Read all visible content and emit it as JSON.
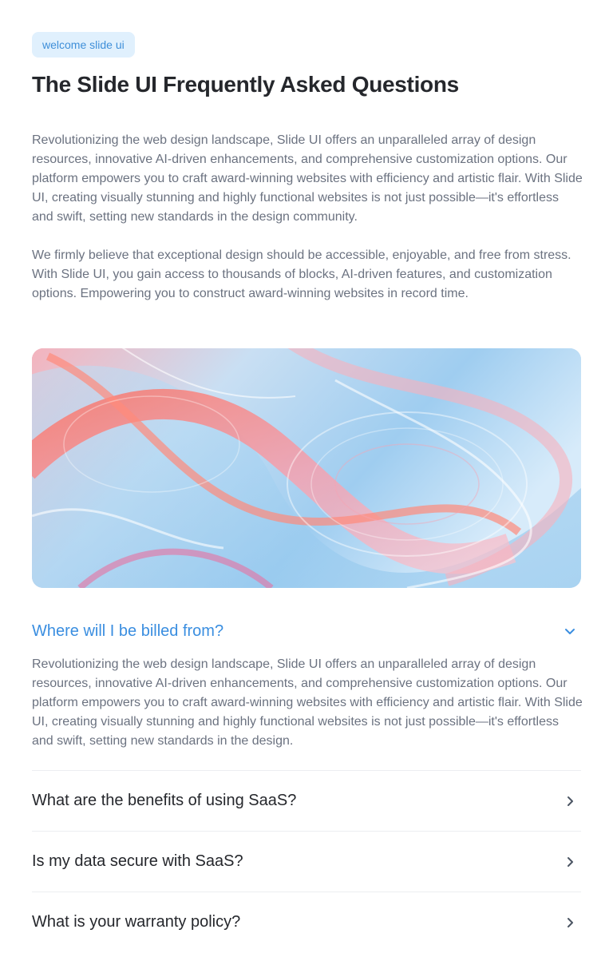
{
  "badge": "welcome slide ui",
  "title": "The Slide UI Frequently Asked Questions",
  "intro": {
    "p1": "Revolutionizing the web design landscape, Slide UI offers an unparalleled array of design resources, innovative AI-driven enhancements, and comprehensive customization options. Our platform empowers you to craft award-winning websites with efficiency and artistic flair. With Slide UI, creating visually stunning and highly functional websites is not just possible—it's effortless and swift, setting new standards in the design community.",
    "p2": "We firmly believe that exceptional design should be accessible, enjoyable, and free from stress. With Slide UI, you gain access to thousands of blocks, AI-driven features, and customization options. Empowering you to construct award-winning websites in record time."
  },
  "faq": {
    "open": {
      "question": "Where will I be billed from?",
      "answer": "Revolutionizing the web design landscape, Slide UI offers an unparalleled array of design resources, innovative AI-driven enhancements, and comprehensive customization options. Our platform empowers you to craft award-winning websites with efficiency and artistic flair. With Slide UI, creating visually stunning and highly functional websites is not just possible—it's effortless and swift, setting new standards in the design.",
      "icon": "chevron-down-icon"
    },
    "items": [
      {
        "question": "What are the benefits of using SaaS?",
        "icon": "chevron-right-icon"
      },
      {
        "question": "Is my data secure with SaaS?",
        "icon": "chevron-right-icon"
      },
      {
        "question": "What is your warranty policy?",
        "icon": "chevron-right-icon"
      }
    ]
  },
  "colors": {
    "accent": "#3a8ee0",
    "badge_bg": "#e0f0fd",
    "text_muted": "#6b7280",
    "text_dark": "#25272c"
  }
}
